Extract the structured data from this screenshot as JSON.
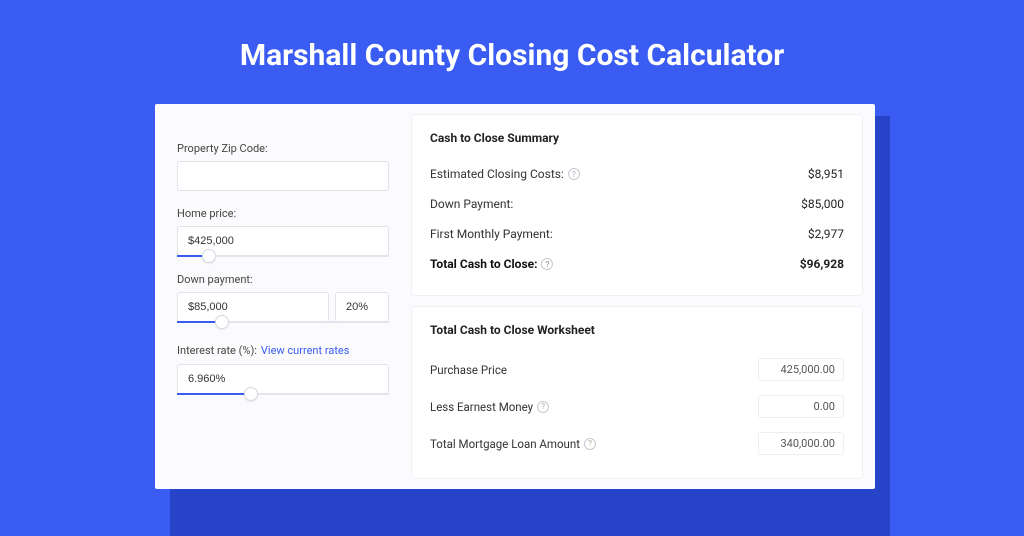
{
  "title": "Marshall County Closing Cost Calculator",
  "inputs": {
    "zip": {
      "label": "Property Zip Code:",
      "value": ""
    },
    "home_price": {
      "label": "Home price:",
      "value": "$425,000",
      "slider_pct": 15
    },
    "down_payment": {
      "label": "Down payment:",
      "value": "$85,000",
      "pct": "20%",
      "slider_pct": 21
    },
    "interest_rate": {
      "label": "Interest rate (%):",
      "link": "View current rates",
      "value": "6.960%",
      "slider_pct": 35
    }
  },
  "summary": {
    "title": "Cash to Close Summary",
    "rows": [
      {
        "label": "Estimated Closing Costs:",
        "help": true,
        "value": "$8,951"
      },
      {
        "label": "Down Payment:",
        "help": false,
        "value": "$85,000"
      },
      {
        "label": "First Monthly Payment:",
        "help": false,
        "value": "$2,977"
      }
    ],
    "total": {
      "label": "Total Cash to Close:",
      "help": true,
      "value": "$96,928"
    }
  },
  "worksheet": {
    "title": "Total Cash to Close Worksheet",
    "rows": [
      {
        "label": "Purchase Price",
        "help": false,
        "value": "425,000.00"
      },
      {
        "label": "Less Earnest Money",
        "help": true,
        "value": "0.00"
      },
      {
        "label": "Total Mortgage Loan Amount",
        "help": true,
        "value": "340,000.00"
      }
    ]
  }
}
